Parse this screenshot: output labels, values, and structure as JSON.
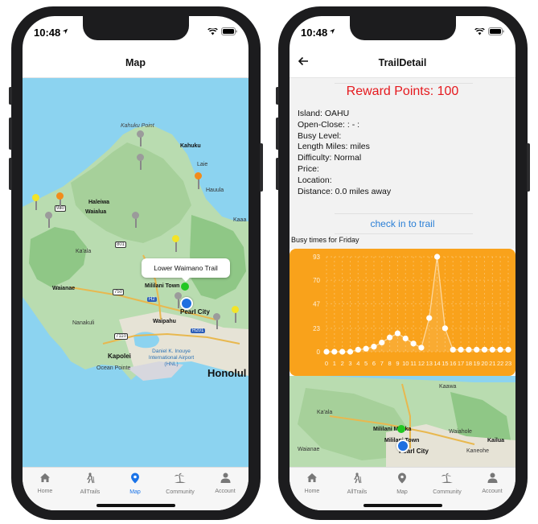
{
  "status_time": "10:48",
  "colors": {
    "accent": "#1a73e8",
    "reward": "#e5191e",
    "link": "#2a7fd6",
    "chart_bg": "#f9a21b"
  },
  "map_screen": {
    "title": "Map",
    "callout": "Lower Waimano Trail",
    "labels": {
      "kahuku_point": "Kahuku Point",
      "kahuku": "Kahuku",
      "laie": "Laie",
      "hauula": "Hauula",
      "haleiwa": "Haleiwa",
      "waialua": "Waialua",
      "kaaa": "Kaaa",
      "kaala": "Ka'ala",
      "mililani": "Mililani Town",
      "waianae": "Waianae",
      "pearl_city": "Pearl City",
      "waipahu": "Waipahu",
      "nanakuli": "Nanakuli",
      "kapolei": "Kapolei",
      "airport": "Daniel K. Inouye International Airport (HNL)",
      "ocean_pointe": "Ocean Pointe",
      "honolulu": "Honolul",
      "route_930": "930",
      "route_801": "801",
      "route_750": "750",
      "route_7110": "7110",
      "route_h2": "H2",
      "route_h201": "H201"
    }
  },
  "detail_screen": {
    "title": "TrailDetail",
    "reward": "Reward Points: 100",
    "info": [
      "Island: OAHU",
      "Open-Close: : - :",
      "Busy Level:",
      "Length Miles:  miles",
      "Difficulty: Normal",
      "Price:",
      "Location:",
      "Distance: 0.0 miles away"
    ],
    "checkin": "check in to trail",
    "busy_title": "Busy times for Friday",
    "map_labels": {
      "kaawa": "Kaawa",
      "kaala": "Ka'ala",
      "mililani": "Mililani Mauka",
      "mililani_town": "Mililani Town",
      "waiahole": "Waiahole",
      "pearl_city": "Pearl City",
      "kaneohe": "Kaneohe",
      "kailua": "Kailua",
      "waianae": "Waianae"
    }
  },
  "tabs": [
    {
      "label": "Home",
      "icon": "home-icon"
    },
    {
      "label": "AllTrails",
      "icon": "hiker-icon"
    },
    {
      "label": "Map",
      "icon": "map-pin-icon"
    },
    {
      "label": "Community",
      "icon": "island-icon"
    },
    {
      "label": "Account",
      "icon": "person-icon"
    }
  ],
  "active_tab_left": "Map",
  "chart_data": {
    "type": "line",
    "title": "Busy times for Friday",
    "x": [
      0,
      1,
      2,
      3,
      4,
      5,
      6,
      7,
      8,
      9,
      10,
      11,
      12,
      13,
      14,
      15,
      16,
      17,
      18,
      19,
      20,
      21,
      22,
      23
    ],
    "x_tick_labels": [
      "0",
      "1",
      "2",
      "3",
      "4",
      "5",
      "6",
      "7",
      "8",
      "9",
      "10",
      "11",
      "12",
      "13",
      "14",
      "15",
      "16",
      "17",
      "18",
      "19",
      "20",
      "21",
      "22",
      "23"
    ],
    "y_ticks": [
      0,
      23,
      47,
      70,
      93
    ],
    "ylim": [
      0,
      93
    ],
    "series": [
      {
        "values": [
          0,
          0,
          0,
          0,
          2,
          3,
          5,
          9,
          14,
          18,
          13,
          8,
          4,
          33,
          93,
          23,
          2,
          2,
          2,
          2,
          2,
          2,
          2,
          2
        ]
      }
    ],
    "grid": true
  }
}
